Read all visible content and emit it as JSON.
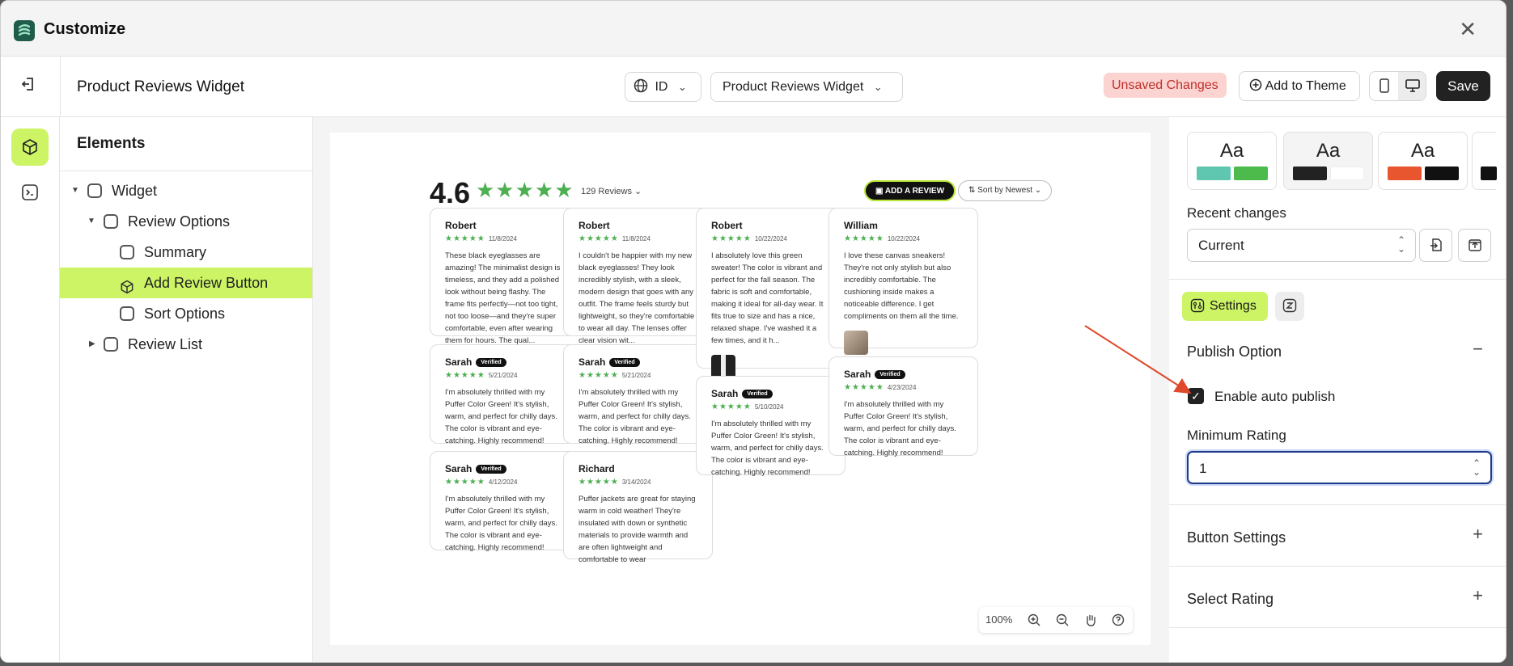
{
  "window": {
    "title": "Customize",
    "close": "✕"
  },
  "topbar": {
    "page_title": "Product Reviews Widget",
    "lang_label": "ID",
    "widget_select": "Product Reviews Widget",
    "unsaved": "Unsaved Changes",
    "add_to_theme": "Add to Theme",
    "save": "Save"
  },
  "elements": {
    "heading": "Elements",
    "tree": [
      {
        "label": "Widget"
      },
      {
        "label": "Review Options"
      },
      {
        "label": "Summary"
      },
      {
        "label": "Add Review Button"
      },
      {
        "label": "Sort Options"
      },
      {
        "label": "Review List"
      }
    ]
  },
  "preview": {
    "rating": "4.6",
    "stars": "★★★★★",
    "review_count": "129 Reviews",
    "add_review": "ADD A REVIEW",
    "sort": "Sort by Newest",
    "verified": "Verified",
    "card_stars": "★★★★★",
    "cards": [
      {
        "name": "Robert",
        "date": "11/8/2024",
        "text": "These black eyeglasses are amazing! The minimalist design is timeless, and they add a polished look without being flashy. The frame fits perfectly—not too tight, not too loose—and they're super comfortable, even after wearing them for hours. The qual..."
      },
      {
        "name": "Robert",
        "date": "11/8/2024",
        "text": "I couldn't be happier with my new black eyeglasses! They look incredibly stylish, with a sleek, modern design that goes with any outfit. The frame feels sturdy but lightweight, so they're comfortable to wear all day. The lenses offer clear vision wit..."
      },
      {
        "name": "Robert",
        "date": "10/22/2024",
        "text": "I absolutely love this green sweater! The color is vibrant and perfect for the fall season. The fabric is soft and comfortable, making it ideal for all-day wear. It fits true to size and has a nice, relaxed shape. I've washed it a few times, and it h..."
      },
      {
        "name": "William",
        "date": "10/22/2024",
        "text": "I love these canvas sneakers! They're not only stylish but also incredibly comfortable. The cushioning inside makes a noticeable difference. I get compliments on them all the time."
      },
      {
        "name": "Sarah",
        "date": "5/21/2024",
        "text": "I'm absolutely thrilled with my Puffer Color Green! It's stylish, warm, and perfect for chilly days. The color is vibrant and eye-catching. Highly recommend!"
      },
      {
        "name": "Sarah",
        "date": "5/21/2024",
        "text": "I'm absolutely thrilled with my Puffer Color Green! It's stylish, warm, and perfect for chilly days. The color is vibrant and eye-catching. Highly recommend!"
      },
      {
        "name": "Sarah",
        "date": "5/10/2024",
        "text": "I'm absolutely thrilled with my Puffer Color Green! It's stylish, warm, and perfect for chilly days. The color is vibrant and eye-catching. Highly recommend!"
      },
      {
        "name": "Sarah",
        "date": "4/23/2024",
        "text": "I'm absolutely thrilled with my Puffer Color Green! It's stylish, warm, and perfect for chilly days. The color is vibrant and eye-catching. Highly recommend!"
      },
      {
        "name": "Sarah",
        "date": "4/12/2024",
        "text": "I'm absolutely thrilled with my Puffer Color Green! It's stylish, warm, and perfect for chilly days. The color is vibrant and eye-catching. Highly recommend!"
      },
      {
        "name": "Richard",
        "date": "3/14/2024",
        "text": "Puffer jackets are great for staying warm in cold weather! They're insulated with down or synthetic materials to provide warmth and are often lightweight and comfortable to wear"
      }
    ],
    "zoom": "100%"
  },
  "settings": {
    "theme_aa": "Aa",
    "recent_changes_label": "Recent changes",
    "recent_changes_value": "Current",
    "tab_settings": "Settings",
    "publish_option": "Publish Option",
    "enable_auto_publish": "Enable auto publish",
    "minimum_rating_label": "Minimum Rating",
    "minimum_rating_value": "1",
    "button_settings": "Button Settings",
    "select_rating": "Select Rating",
    "collapse_sign": "−",
    "expand_sign": "+"
  },
  "colors": {
    "accent": "#ccf465",
    "star": "#4caf50",
    "unsaved_bg": "#fbd3d1",
    "unsaved_text": "#c0302b",
    "focus": "#1d3a8a"
  }
}
